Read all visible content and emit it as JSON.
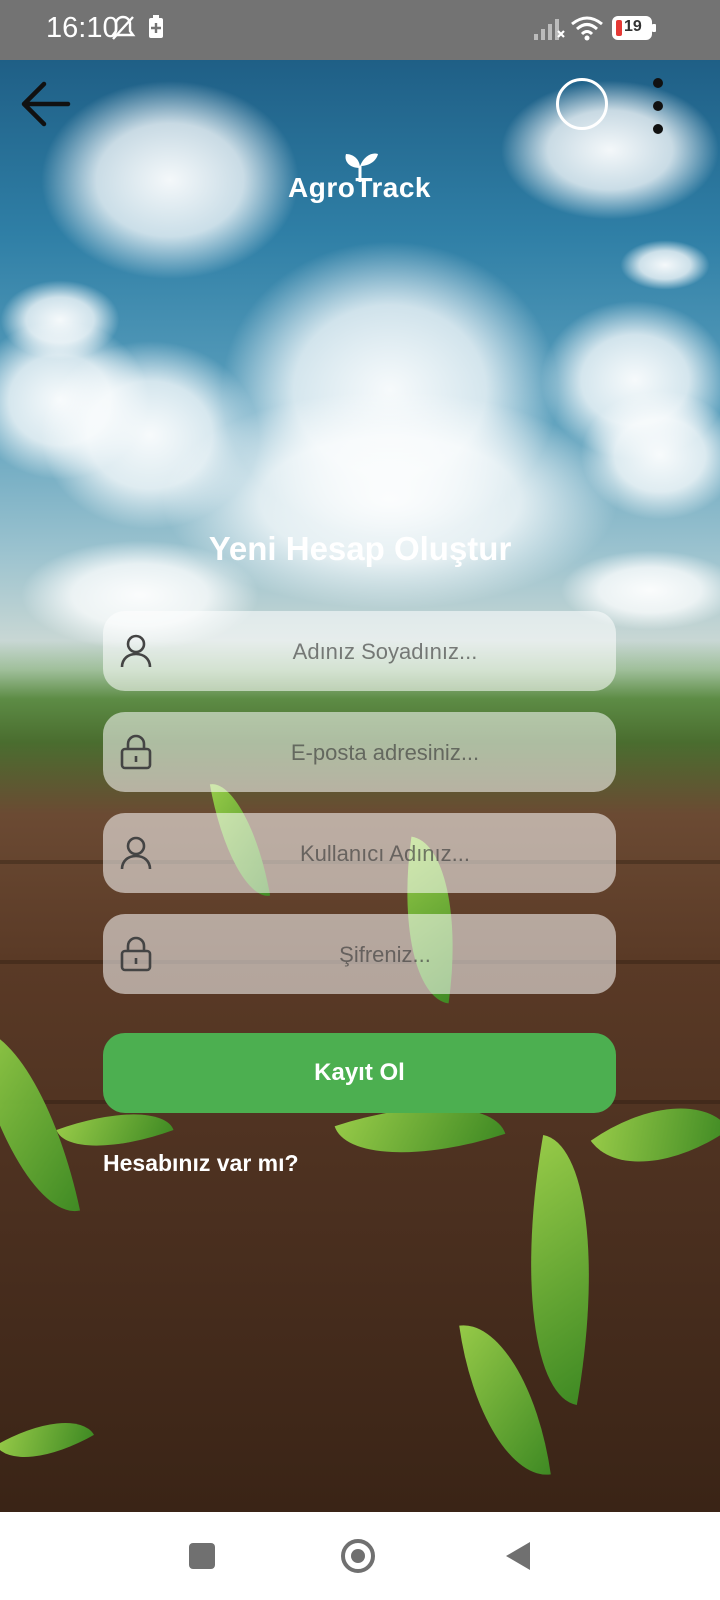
{
  "status_bar": {
    "time": "16:10",
    "battery_level": "19",
    "icons": [
      "bell-off-icon",
      "battery-saver-icon",
      "signal-off-icon",
      "wifi-icon",
      "battery-icon"
    ]
  },
  "toolbar": {
    "back_icon": "arrow-left-icon",
    "circle_icon": "circle-icon",
    "more_icon": "more-vertical-icon"
  },
  "logo": {
    "text": "AgroTrack",
    "icon": "sprout-icon"
  },
  "form": {
    "title": "Yeni Hesap Oluştur",
    "fields": [
      {
        "placeholder": "Adınız Soyadınız...",
        "value": "",
        "icon": "user-icon"
      },
      {
        "placeholder": "E-posta adresiniz...",
        "value": "",
        "icon": "lock-icon"
      },
      {
        "placeholder": "Kullanıcı Adınız...",
        "value": "",
        "icon": "user-icon"
      },
      {
        "placeholder": "Şifreniz...",
        "value": "",
        "icon": "lock-icon"
      }
    ],
    "submit_label": "Kayıt Ol",
    "login_prompt": "Hesabınız var mı?"
  },
  "colors": {
    "accent": "#4caf50",
    "status_bar": "#737373",
    "battery_low": "#e53935"
  },
  "nav_bar": {
    "icons": [
      "recents-square-icon",
      "home-circle-icon",
      "back-triangle-icon"
    ]
  }
}
